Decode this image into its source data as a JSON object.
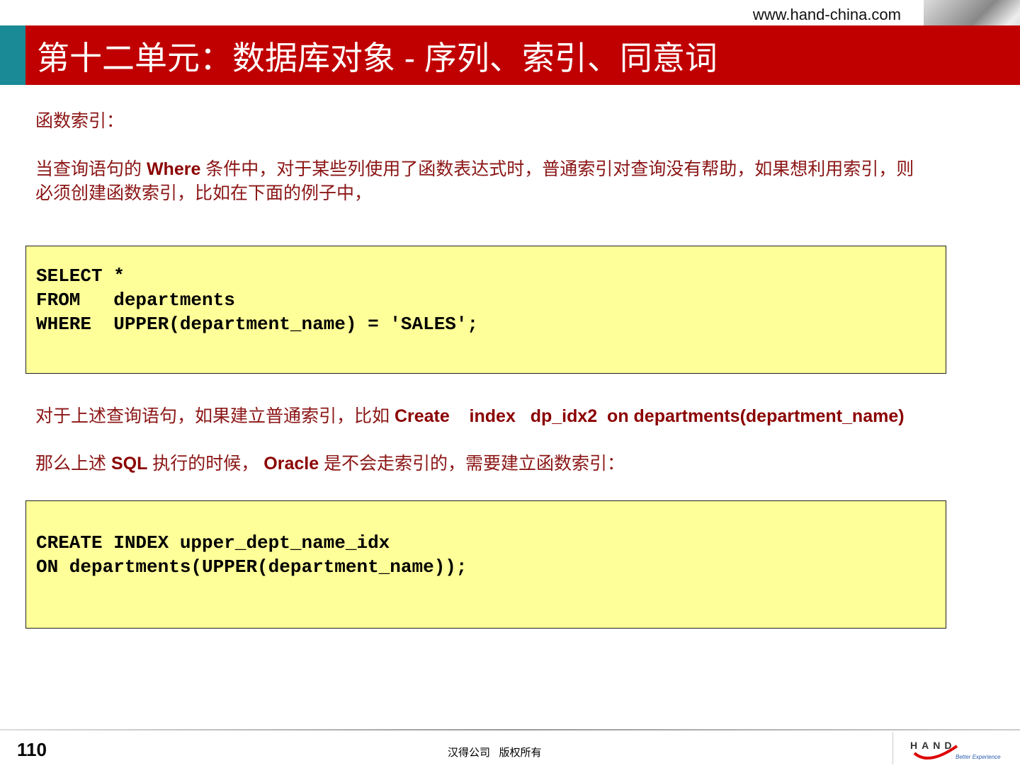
{
  "header": {
    "url": "www.hand-china.com",
    "title": "第十二单元：数据库对象 - 序列、索引、同意词"
  },
  "body": {
    "heading": "函数索引：",
    "p1_a": "当查询语句的 ",
    "p1_b": "Where",
    "p1_c": " 条件中，对于某些列使用了函数表达式时，普通索引对查询没有帮助，如果想利用索引，则",
    "p1_line2": "必须创建函数索引，比如在下面的例子中，",
    "code1": "SELECT *\nFROM   departments\nWHERE  UPPER(department_name) = 'SALES';",
    "p2_a": "对于上述查询语句，如果建立普通索引，比如 ",
    "p2_b": "Create    index   dp_idx2  on departments(department_name)",
    "p3_a": "那么上述 ",
    "p3_b": "SQL",
    "p3_c": " 执行的时候， ",
    "p3_d": "Oracle",
    "p3_e": " 是不会走索引的，需要建立函数索引：",
    "code2": "CREATE INDEX upper_dept_name_idx\nON departments(UPPER(department_name));"
  },
  "footer": {
    "page": "110",
    "copyright": "汉得公司   版权所有",
    "logo_text": "HAND",
    "logo_tagline": "Better Experience"
  }
}
